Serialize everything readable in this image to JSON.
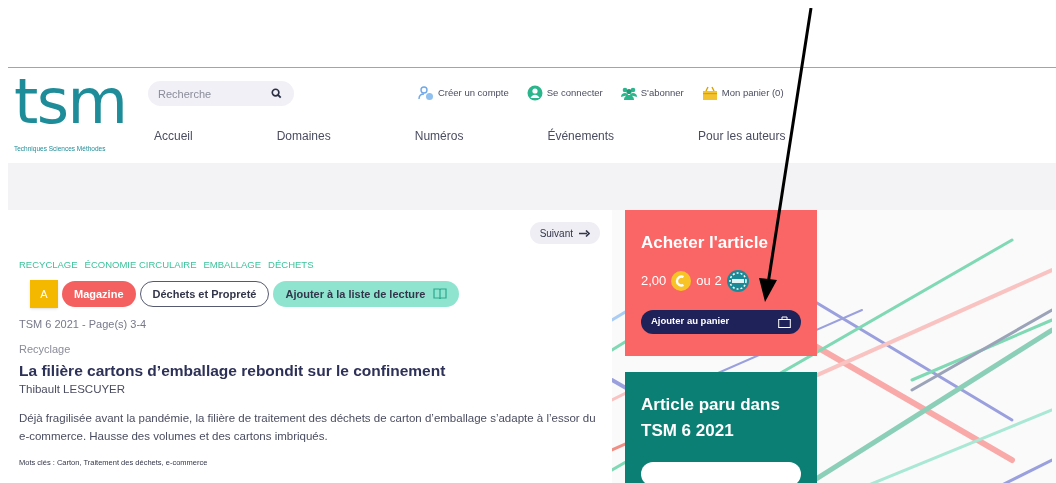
{
  "header": {
    "logo": {
      "text": "tsm",
      "tagline": "Techniques Sciences Méthodes"
    },
    "search": {
      "placeholder": "Recherche"
    },
    "account_links": [
      {
        "kind": "create",
        "label": "Créer un compte"
      },
      {
        "kind": "login",
        "label": "Se connecter"
      },
      {
        "kind": "subscribe",
        "label": "S'abonner"
      },
      {
        "kind": "cart",
        "label": "Mon panier (0)"
      }
    ],
    "nav": [
      "Accueil",
      "Domaines",
      "Numéros",
      "Événements",
      "Pour les auteurs"
    ]
  },
  "article": {
    "next_button": "Suivant",
    "tags": [
      "RECYCLAGE",
      "ÉCONOMIE CIRCULAIRE",
      "EMBALLAGE",
      "DÉCHETS"
    ],
    "badges": [
      {
        "kind": "grade",
        "label": "A"
      },
      {
        "kind": "category",
        "label": "Magazine"
      },
      {
        "kind": "outline",
        "label": "Déchets et Propreté"
      },
      {
        "kind": "reading_list",
        "label": "Ajouter à la liste de lecture"
      }
    ],
    "issue": "TSM 6 2021 - Page(s) 3-4",
    "section": "Recyclage",
    "title": "La filière cartons d’emballage rebondit sur le confinement",
    "author": "Thibault LESCUYER",
    "summary": "Déjà fragilisée avant la pandémie, la filière de traitement des déchets de carton d’emballage s’adapte à l’essor du e-commerce. Hausse des volumes et des cartons imbriqués.",
    "keywords": "Mots clés : Carton, Traitement des déchets, e-commerce"
  },
  "purchase": {
    "title": "Acheter l'article",
    "price": "2,00",
    "or_text": "ou 2",
    "button": "Ajouter au panier"
  },
  "issue_card": {
    "title": "Article paru dans TSM 6 2021"
  }
}
